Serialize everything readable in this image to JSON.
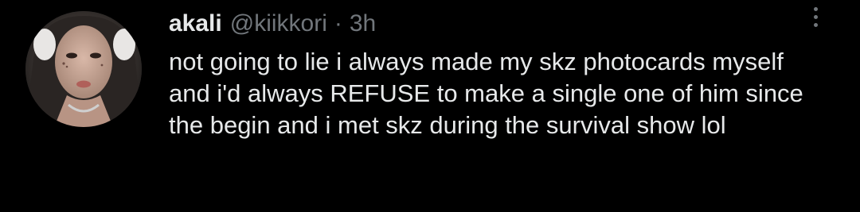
{
  "tweet": {
    "display_name": "akali",
    "handle": "@kiikkori",
    "separator": "·",
    "time": "3h",
    "text": "not going to lie i always made my skz photocards myself and i'd always REFUSE to make a single one of him since the begin and i met skz during the survival show lol",
    "more_icon": "more-vertical-icon"
  },
  "colors": {
    "background": "#000000",
    "primary_text": "#e7e9ea",
    "secondary_text": "#71767b"
  }
}
